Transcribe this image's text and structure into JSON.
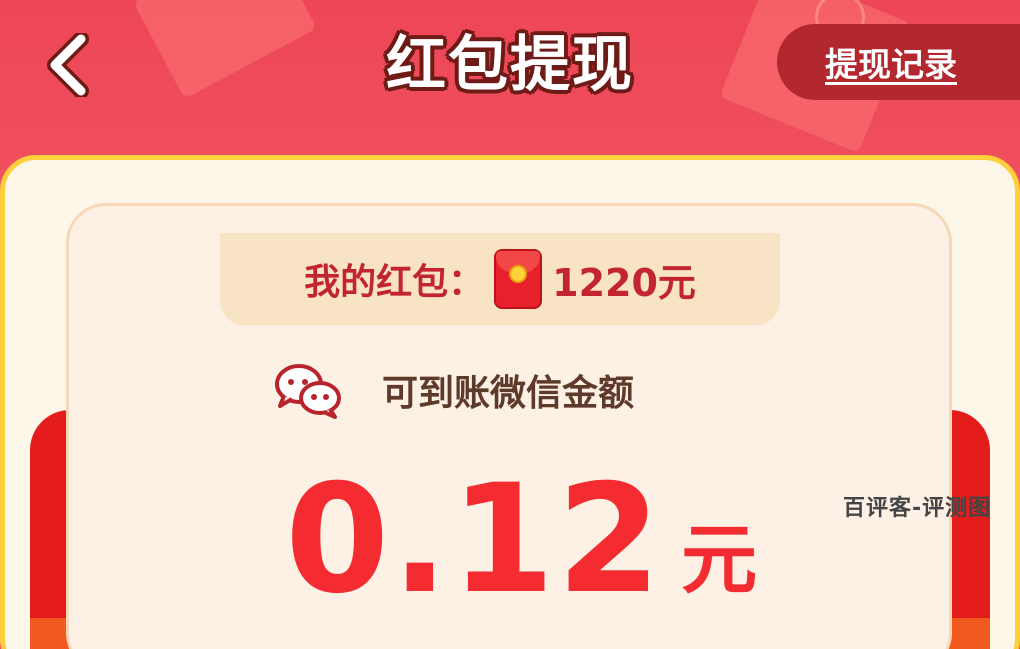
{
  "header": {
    "title": "红包提现",
    "record_label": "提现记录",
    "back_icon": "chevron-left-icon"
  },
  "balance": {
    "label": "我的红包：",
    "value": "1220元",
    "icon": "red-envelope-icon"
  },
  "withdraw": {
    "label": "可到账微信金额",
    "icon": "wechat-icon",
    "amount": "0.12",
    "unit": "元"
  },
  "watermark": "百评客-评测图",
  "colors": {
    "header_bg": "#ee4656",
    "accent_red": "#f42c32",
    "card_border": "#ffcf3e",
    "record_button": "#b3272f"
  }
}
